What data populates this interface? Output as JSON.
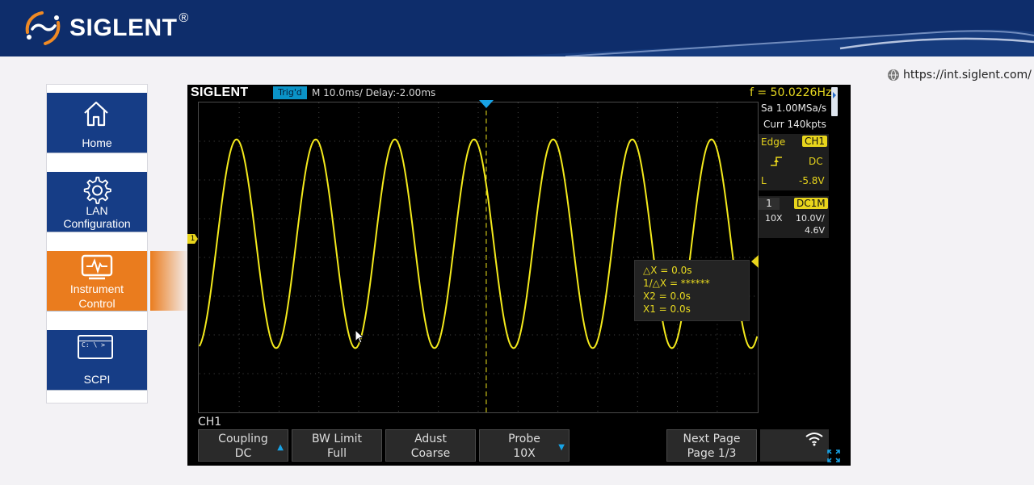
{
  "header": {
    "brand": "SIGLENT",
    "reg": "®"
  },
  "url": "https://int.siglent.com/",
  "sidebar": {
    "items": [
      {
        "label": "Home",
        "icon": "home-icon"
      },
      {
        "label_line1": "LAN",
        "label_line2": "Configuration",
        "icon": "gear-icon"
      },
      {
        "label_line1": "Instrument",
        "label_line2": "Control",
        "icon": "monitor-icon",
        "active": true
      },
      {
        "label": "SCPI",
        "icon": "terminal-icon",
        "terminal_text": "C: \\ >"
      }
    ]
  },
  "scope": {
    "brand": "SIGLENT",
    "trigger_status": "Trig'd",
    "timebase": "M 10.0ms/ Delay:-2.00ms",
    "frequency": "f = 50.0226Hz",
    "sample_rate": "Sa 1.00MSa/s",
    "memory": "Curr 140kpts",
    "trigger": {
      "type": "Edge",
      "source": "CH1",
      "coupling": "DC",
      "level_label": "L",
      "level": "-5.8V"
    },
    "channel": {
      "number": "1",
      "coupling": "DC1M",
      "probe": "10X",
      "scale": "10.0V/",
      "offset": "4.6V"
    },
    "ch_marker": "1",
    "cursor": {
      "dx": "△X = 0.0s",
      "inv_dx": "1/△X = ******",
      "x2": "X2 = 0.0s",
      "x1": "X1 = 0.0s"
    },
    "menu_label": "CH1",
    "softkeys": [
      {
        "line1": "Coupling",
        "line2": "DC",
        "arrow": "▲"
      },
      {
        "line1": "BW Limit",
        "line2": "Full"
      },
      {
        "line1": "Adust",
        "line2": "Coarse"
      },
      {
        "line1": "Probe",
        "line2": "10X",
        "arrow": "▼"
      },
      {
        "line1": "Next Page",
        "line2": "Page 1/3"
      }
    ]
  },
  "colors": {
    "header": "#0e2d6b",
    "nav": "#163d86",
    "active": "#ea7c1e",
    "trace": "#f4ea1c",
    "accent": "#0a93c7"
  }
}
